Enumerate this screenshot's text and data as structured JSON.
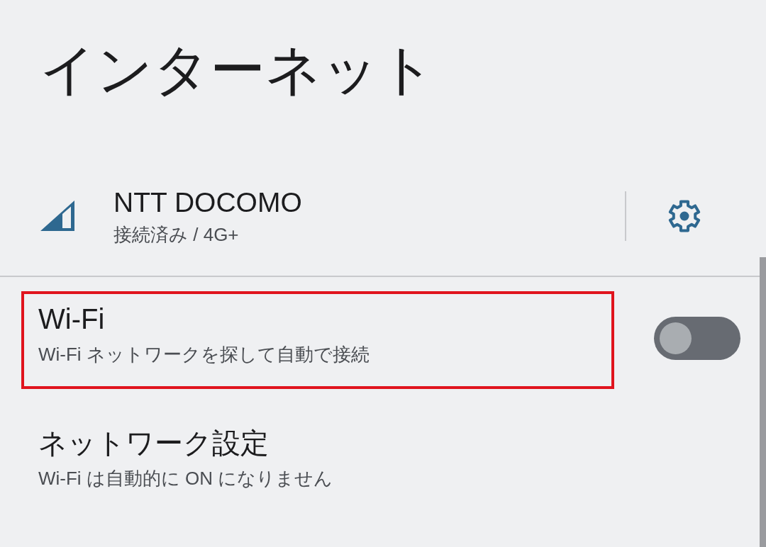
{
  "title": "インターネット",
  "mobile_network": {
    "name": "NTT DOCOMO",
    "status": "接続済み / 4G+"
  },
  "items": [
    {
      "kind": "toggle",
      "title": "Wi-Fi",
      "subtitle": "Wi-Fi ネットワークを探して自動で接続",
      "on": false,
      "highlighted": true
    },
    {
      "kind": "link",
      "title": "ネットワーク設定",
      "subtitle": "Wi-Fi は自動的に ON になりません",
      "highlighted": false
    }
  ]
}
